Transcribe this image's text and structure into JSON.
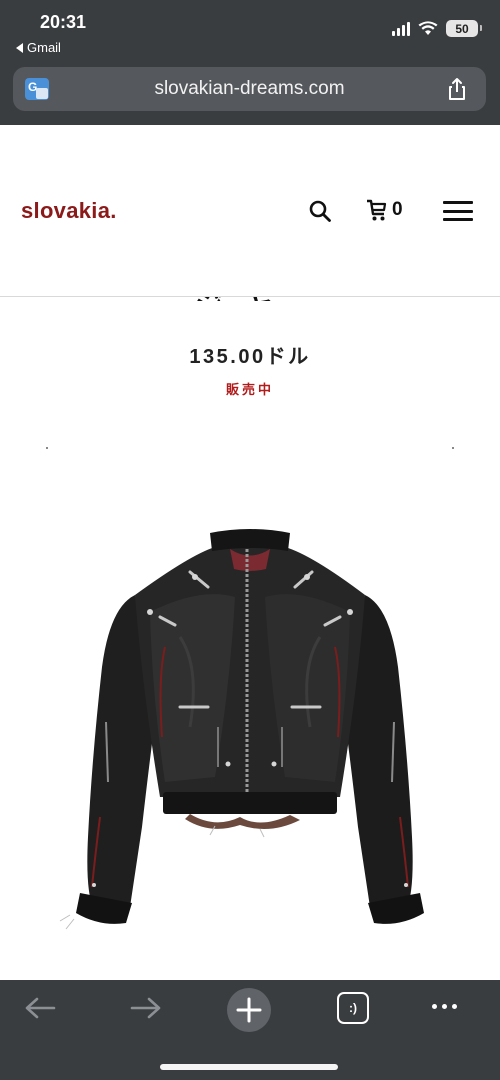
{
  "status_bar": {
    "time": "20:31",
    "back_app": "Gmail",
    "battery": "50",
    "icons": [
      "cellular-signal-icon",
      "wifi-icon",
      "battery-icon"
    ]
  },
  "browser": {
    "url": "slovakian-dreams.com",
    "icons": [
      "translate-icon",
      "share-icon"
    ]
  },
  "header": {
    "logo": "slovakia.",
    "cart_count": "0",
    "icons": [
      "search-icon",
      "cart-icon",
      "menu-icon"
    ]
  },
  "product": {
    "title_fragment": "ジャ",
    "price": "135.00ドル",
    "status": "販売中",
    "image_alt": "black bomber jacket with silver hardware and red piping"
  },
  "toolbar": {
    "tabs_label": ":)",
    "icons": [
      "back-arrow-icon",
      "forward-arrow-icon",
      "plus-icon",
      "tabs-icon",
      "more-icon"
    ]
  },
  "colors": {
    "brand": "#8b1a1a",
    "status_red": "#b21b1b",
    "chrome": "#3a3d40",
    "urlbar": "#55585c"
  }
}
